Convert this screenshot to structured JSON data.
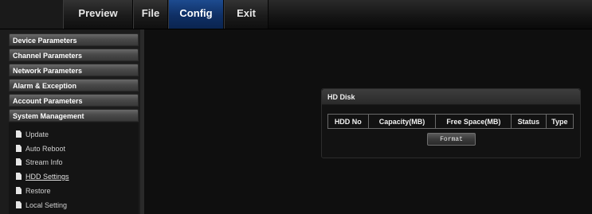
{
  "nav": {
    "tabs": [
      {
        "label": "Preview"
      },
      {
        "label": "File"
      },
      {
        "label": "Config",
        "active": true
      },
      {
        "label": "Exit"
      }
    ]
  },
  "sidebar": {
    "headers": [
      {
        "label": "Device Parameters"
      },
      {
        "label": "Channel Parameters"
      },
      {
        "label": "Network Parameters"
      },
      {
        "label": "Alarm & Exception"
      },
      {
        "label": "Account Parameters"
      },
      {
        "label": "System Management"
      }
    ],
    "sub_items": [
      {
        "label": "Update",
        "icon": "document-icon"
      },
      {
        "label": "Auto Reboot",
        "icon": "document-icon"
      },
      {
        "label": "Stream Info",
        "icon": "document-icon"
      },
      {
        "label": "HDD Settings",
        "icon": "document-icon",
        "active": true
      },
      {
        "label": "Restore",
        "icon": "document-icon"
      },
      {
        "label": "Local Setting",
        "icon": "document-icon"
      }
    ]
  },
  "hd_disk": {
    "title": "HD Disk",
    "columns": [
      "HDD No",
      "Capacity(MB)",
      "Free Space(MB)",
      "Status",
      "Type"
    ],
    "format_button": "Format"
  },
  "colors": {
    "active_tab": "#0f2f64",
    "background": "#0e0e0e"
  }
}
